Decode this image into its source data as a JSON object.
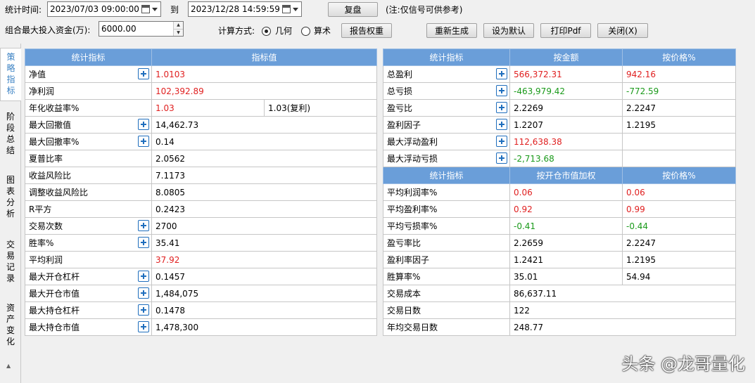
{
  "toolbar": {
    "period_label": "统计时间:",
    "start_time": "2023/07/03 09:00:00",
    "to_label": "到",
    "end_time": "2023/12/28 14:59:59",
    "review_button": "复盘",
    "note": "(注:仅信号可供参考)",
    "max_capital_label": "组合最大投入资金(万):",
    "max_capital_value": "6000.00",
    "calc_method_label": "计算方式:",
    "calc_options": [
      "几何",
      "算术"
    ],
    "calc_selected": "几何",
    "report_weight_button": "报告权重",
    "regenerate_button": "重新生成",
    "set_default_button": "设为默认",
    "print_pdf_button": "打印Pdf",
    "close_button": "关闭(X)"
  },
  "side_tabs": [
    "策略指标",
    "阶段总结",
    "图表分析",
    "交易记录",
    "资产变化"
  ],
  "active_tab": "策略指标",
  "left_table": {
    "headers": [
      "统计指标",
      "指标值"
    ],
    "rows": [
      {
        "name": "净值",
        "value": "1.0103",
        "color": "red",
        "expand": true
      },
      {
        "name": "净利润",
        "value": "102,392.89",
        "color": "red",
        "expand": false
      },
      {
        "name": "年化收益率%",
        "value": "1.03",
        "extra": "1.03(复利)",
        "color": "red",
        "expand": false
      },
      {
        "name": "最大回撤值",
        "value": "14,462.73",
        "color": "black",
        "expand": true
      },
      {
        "name": "最大回撤率%",
        "value": "0.14",
        "color": "black",
        "expand": true
      },
      {
        "name": "夏普比率",
        "value": "2.0562",
        "color": "black",
        "expand": false
      },
      {
        "name": "收益风险比",
        "value": "7.1173",
        "color": "black",
        "expand": false
      },
      {
        "name": "调整收益风险比",
        "value": "8.0805",
        "color": "black",
        "expand": false
      },
      {
        "name": "R平方",
        "value": "0.2423",
        "color": "black",
        "expand": false
      },
      {
        "name": "交易次数",
        "value": "2700",
        "color": "black",
        "expand": true
      },
      {
        "name": "胜率%",
        "value": "35.41",
        "color": "black",
        "expand": true
      },
      {
        "name": "平均利润",
        "value": "37.92",
        "color": "red",
        "expand": false
      },
      {
        "name": "最大开仓杠杆",
        "value": "0.1457",
        "color": "black",
        "expand": true
      },
      {
        "name": "最大开仓市值",
        "value": "1,484,075",
        "color": "black",
        "expand": true
      },
      {
        "name": "最大持仓杠杆",
        "value": "0.1478",
        "color": "black",
        "expand": true
      },
      {
        "name": "最大持仓市值",
        "value": "1,478,300",
        "color": "black",
        "expand": true
      }
    ]
  },
  "right_table_1": {
    "headers": [
      "统计指标",
      "按金额",
      "按价格%"
    ],
    "rows": [
      {
        "name": "总盈利",
        "v1": "566,372.31",
        "v2": "942.16",
        "color": "red",
        "expand": true
      },
      {
        "name": "总亏损",
        "v1": "-463,979.42",
        "v2": "-772.59",
        "color": "green",
        "expand": true
      },
      {
        "name": "盈亏比",
        "v1": "2.2269",
        "v2": "2.2247",
        "color": "black",
        "expand": true
      },
      {
        "name": "盈利因子",
        "v1": "1.2207",
        "v2": "1.2195",
        "color": "black",
        "expand": true
      },
      {
        "name": "最大浮动盈利",
        "v1": "112,638.38",
        "v2": "",
        "color": "red",
        "expand": true
      },
      {
        "name": "最大浮动亏损",
        "v1": "-2,713.68",
        "v2": "",
        "color": "green",
        "expand": true
      }
    ]
  },
  "right_table_2": {
    "headers": [
      "统计指标",
      "按开仓市值加权",
      "按价格%"
    ],
    "rows": [
      {
        "name": "平均利润率%",
        "v1": "0.06",
        "v2": "0.06",
        "color": "red"
      },
      {
        "name": "平均盈利率%",
        "v1": "0.92",
        "v2": "0.99",
        "color": "red"
      },
      {
        "name": "平均亏损率%",
        "v1": "-0.41",
        "v2": "-0.44",
        "color": "green"
      },
      {
        "name": "盈亏率比",
        "v1": "2.2659",
        "v2": "2.2247",
        "color": "black"
      },
      {
        "name": "盈利率因子",
        "v1": "1.2421",
        "v2": "1.2195",
        "color": "black"
      },
      {
        "name": "胜算率%",
        "v1": "35.01",
        "v2": "54.94",
        "color": "black"
      },
      {
        "name": "交易成本",
        "v1": "86,637.11",
        "v2": null,
        "color": "black"
      },
      {
        "name": "交易日数",
        "v1": "122",
        "v2": null,
        "color": "black"
      },
      {
        "name": "年均交易日数",
        "v1": "248.77",
        "v2": null,
        "color": "black"
      }
    ]
  },
  "watermark": "头条 @龙哥量化",
  "colors": {
    "header_bg": "#6a9ed9",
    "positive": "#e02020",
    "negative": "#1a9a1a",
    "active_tab": "#3b82c4",
    "expand_icon": "#1f6ebd"
  }
}
